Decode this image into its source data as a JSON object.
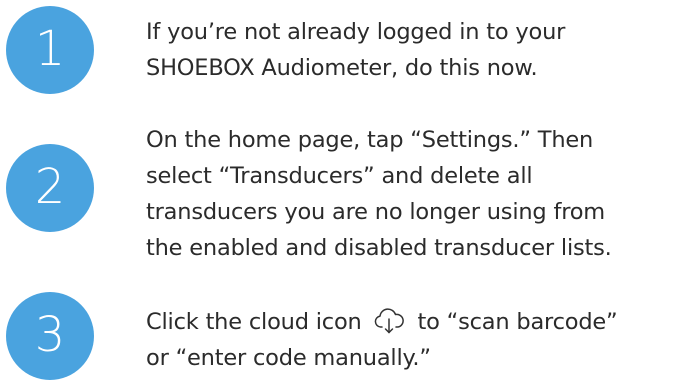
{
  "colors": {
    "badge": "#4aa3df",
    "text": "#2b2b2b",
    "icon_stroke": "#333333"
  },
  "steps": [
    {
      "number": "1",
      "lines": [
        "If you’re not already logged in to your",
        "SHOEBOX Audiometer, do this now."
      ]
    },
    {
      "number": "2",
      "lines": [
        "On the home page, tap “Settings.” Then",
        "select “Transducers” and delete all",
        "transducers you are no longer using from",
        "the enabled and disabled transducer lists."
      ]
    },
    {
      "number": "3",
      "line1_before_icon": "Click the cloud icon",
      "line1_after_icon": "to “scan barcode”",
      "line2": "or “enter code manually.”",
      "icon": "cloud-download-icon"
    }
  ]
}
